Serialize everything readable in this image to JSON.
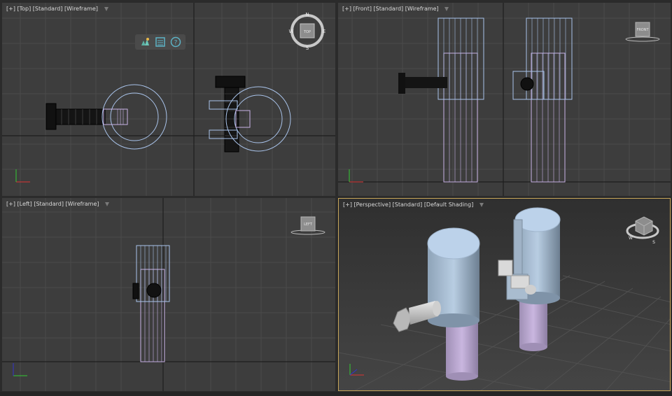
{
  "viewports": {
    "top": {
      "plus": "[+]",
      "view": "[Top]",
      "style": "[Standard]",
      "shading": "[Wireframe]",
      "cube_label": "TOP",
      "compass": {
        "n": "N",
        "e": "E",
        "s": "S",
        "w": "W"
      }
    },
    "front": {
      "plus": "[+]",
      "view": "[Front]",
      "style": "[Standard]",
      "shading": "[Wireframe]",
      "cube_label": "FRONT"
    },
    "left": {
      "plus": "[+]",
      "view": "[Left]",
      "style": "[Standard]",
      "shading": "[Wireframe]",
      "cube_label": "LEFT"
    },
    "perspective": {
      "plus": "[+]",
      "view": "[Perspective]",
      "style": "[Standard]",
      "shading": "[Default Shading]",
      "compass": {
        "w": "W",
        "s": "S"
      }
    }
  },
  "mini_toolbar": {
    "icons": [
      "scene-explorer-icon",
      "layer-list-icon",
      "help-icon"
    ],
    "help_glyph": "?"
  },
  "colors": {
    "viewport_bg": "#3d3d3d",
    "grid": "#4a4a4a",
    "axis": "#1e1e1e",
    "wire_blue": "#a9c3ea",
    "wire_purple": "#c9b2e6",
    "wire_black": "#0a0a0a",
    "active_border": "#c7a65a"
  }
}
